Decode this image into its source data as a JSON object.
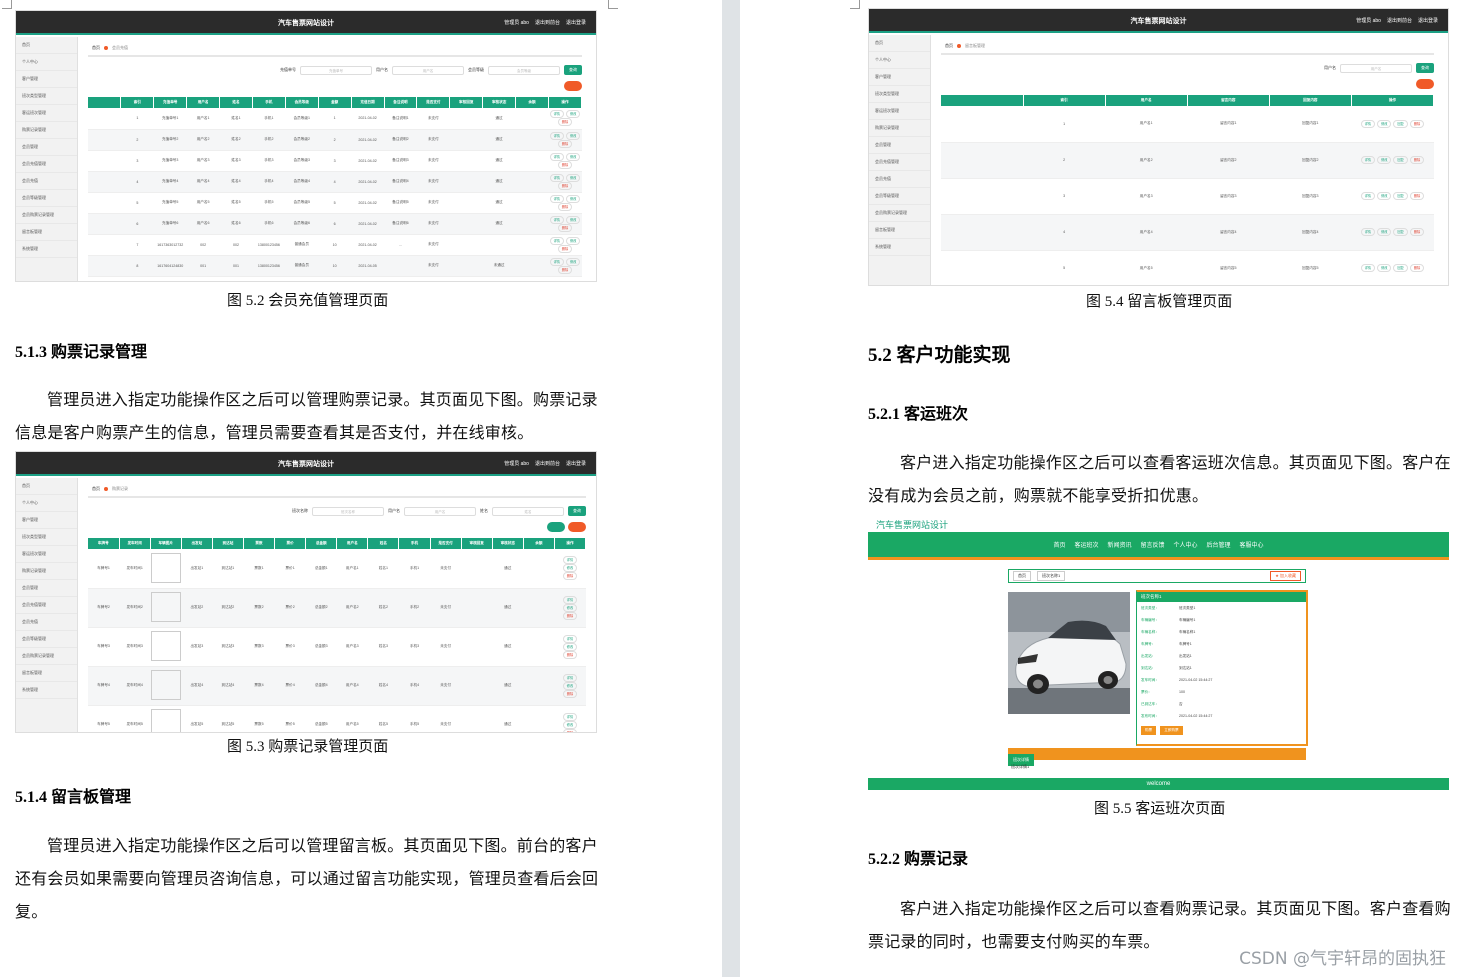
{
  "app": {
    "title": "汽车售票网站设计",
    "header_links": [
      "管理员 abo",
      "退出到前台",
      "退出登录"
    ]
  },
  "sidebar_full": [
    "首页",
    "个人中心",
    "客户管理",
    "班次类型管理",
    "客运班次管理",
    "购票记录管理",
    "会员管理",
    "会员充值管理",
    "会员充值",
    "会员等级管理",
    "会员购票记录管理",
    "留言板管理",
    "系统管理"
  ],
  "fig52": {
    "crumb_home": "首页",
    "crumb_current": "会员充值",
    "search": [
      {
        "label": "充值单号",
        "placeholder": "充值单号"
      },
      {
        "label": "用户名",
        "placeholder": "用户名"
      },
      {
        "label": "会员等级",
        "placeholder": "会员等级"
      }
    ],
    "search_btn": "查询",
    "columns": [
      "",
      "索引",
      "充值单号",
      "用户名",
      "姓名",
      "手机",
      "会员等级",
      "金额",
      "充值日期",
      "备注说明",
      "是否支付",
      "审核回复",
      "审核状态",
      "余额",
      "操作"
    ],
    "rows": [
      [
        "",
        "1",
        "充值单号1",
        "用户名1",
        "姓名1",
        "手机1",
        "会员等级1",
        "1",
        "2021-04-02",
        "备注说明1",
        "未支付",
        "",
        "通过",
        "",
        "详情 修改 删除"
      ],
      [
        "",
        "2",
        "充值单号2",
        "用户名2",
        "姓名2",
        "手机2",
        "会员等级2",
        "2",
        "2021-04-02",
        "备注说明2",
        "未支付",
        "",
        "通过",
        "",
        "详情 修改 删除"
      ],
      [
        "",
        "3",
        "充值单号3",
        "用户名3",
        "姓名3",
        "手机3",
        "会员等级3",
        "3",
        "2021-04-02",
        "备注说明3",
        "未支付",
        "",
        "通过",
        "",
        "详情 修改 删除"
      ],
      [
        "",
        "4",
        "充值单号4",
        "用户名4",
        "姓名4",
        "手机4",
        "会员等级4",
        "4",
        "2021-04-02",
        "备注说明4",
        "未支付",
        "",
        "通过",
        "",
        "详情 修改 删除"
      ],
      [
        "",
        "5",
        "充值单号5",
        "用户名5",
        "姓名5",
        "手机5",
        "会员等级5",
        "5",
        "2021-04-02",
        "备注说明5",
        "未支付",
        "",
        "通过",
        "",
        "详情 修改 删除"
      ],
      [
        "",
        "6",
        "充值单号6",
        "用户名6",
        "姓名6",
        "手机6",
        "会员等级6",
        "6",
        "2021-04-02",
        "备注说明6",
        "未支付",
        "",
        "通过",
        "",
        "详情 修改 删除"
      ],
      [
        "",
        "7",
        "1617363012732",
        "002",
        "002",
        "13800123456",
        "普通会员",
        "10",
        "2021-04-02",
        "...",
        "未支付",
        "",
        "",
        "",
        "详情 修改 删除"
      ],
      [
        "",
        "8",
        "1617604124830",
        "001",
        "001",
        "13800123456",
        "普通会员",
        "10",
        "2021-04-05",
        "",
        "未支付",
        "",
        "未通过",
        "",
        "详情 修改 删除"
      ]
    ]
  },
  "fig53": {
    "crumb_home": "首页",
    "crumb_current": "购票记录",
    "search": [
      {
        "label": "班次名称",
        "placeholder": "班次名称"
      },
      {
        "label": "用户名",
        "placeholder": "用户名"
      },
      {
        "label": "姓名",
        "placeholder": "姓名"
      }
    ],
    "search_btn": "查询",
    "columns": [
      "车牌号",
      "发车时间",
      "车辆图片",
      "出发站",
      "到达站",
      "票数",
      "票价",
      "总金额",
      "用户名",
      "姓名",
      "手机",
      "是否支付",
      "审核回复",
      "审核状态",
      "余额",
      "操作"
    ],
    "rows": [
      [
        "车牌号1",
        "发车时间1",
        "",
        "出发站1",
        "到达站1",
        "票数1",
        "票价1",
        "总金额1",
        "用户名1",
        "姓名1",
        "手机1",
        "未支付",
        "",
        "通过",
        "",
        "详情 修改 删除"
      ],
      [
        "车牌号2",
        "发车时间2",
        "",
        "出发站2",
        "到达站2",
        "票数2",
        "票价2",
        "总金额2",
        "用户名2",
        "姓名2",
        "手机2",
        "未支付",
        "",
        "通过",
        "",
        "详情 修改 删除"
      ],
      [
        "车牌号3",
        "发车时间3",
        "",
        "出发站3",
        "到达站3",
        "票数3",
        "票价3",
        "总金额3",
        "用户名3",
        "姓名3",
        "手机3",
        "未支付",
        "",
        "通过",
        "",
        "详情 修改 删除"
      ],
      [
        "车牌号4",
        "发车时间4",
        "",
        "出发站4",
        "到达站4",
        "票数4",
        "票价4",
        "总金额4",
        "用户名4",
        "姓名4",
        "手机4",
        "未支付",
        "",
        "通过",
        "",
        "详情 修改 删除"
      ],
      [
        "车牌号5",
        "发车时间5",
        "",
        "出发站5",
        "到达站5",
        "票数5",
        "票价5",
        "总金额5",
        "用户名5",
        "姓名5",
        "手机5",
        "未支付",
        "",
        "通过",
        "",
        "详情 修改 删除"
      ]
    ]
  },
  "fig54": {
    "crumb_home": "首页",
    "crumb_current": "留言板管理",
    "search": [
      {
        "label": "用户名",
        "placeholder": "用户名"
      }
    ],
    "search_btn": "查询",
    "columns": [
      "",
      "索引",
      "用户名",
      "留言内容",
      "回复内容",
      "操作"
    ],
    "rows": [
      [
        "",
        "1",
        "用户名1",
        "留言内容1",
        "回复内容1",
        "详情 修改 回复 删除"
      ],
      [
        "",
        "2",
        "用户名2",
        "留言内容2",
        "回复内容2",
        "详情 修改 回复 删除"
      ],
      [
        "",
        "3",
        "用户名3",
        "留言内容3",
        "回复内容3",
        "详情 修改 回复 删除"
      ],
      [
        "",
        "4",
        "用户名4",
        "留言内容4",
        "回复内容4",
        "详情 修改 回复 删除"
      ],
      [
        "",
        "5",
        "用户名5",
        "留言内容5",
        "回复内容5",
        "详情 修改 回复 删除"
      ]
    ]
  },
  "fig55": {
    "site_title": "汽车售票网站设计",
    "nav": [
      "首页",
      "客运班次",
      "新闻资讯",
      "留言反馈",
      "个人中心",
      "后台管理",
      "客服中心"
    ],
    "bar": [
      "首页",
      "班次名称1"
    ],
    "fav": "★ 加入收藏",
    "info_title": "班次名称1",
    "info_rows": [
      [
        "班次类型：",
        "班次类型1"
      ],
      [
        "车辆编号：",
        "车辆编号1"
      ],
      [
        "车辆名称：",
        "车辆名称1"
      ],
      [
        "车牌号：",
        "车牌号1"
      ],
      [
        "出发站：",
        "出发站1"
      ],
      [
        "到达站：",
        "到达站1"
      ],
      [
        "发车时间：",
        "2021-04-02 15:44:27"
      ],
      [
        "票价：",
        "100"
      ],
      [
        "已到达车：",
        "否"
      ],
      [
        "发布时间：",
        "2021-04-02 15:44:27"
      ]
    ],
    "buttons": [
      "购票",
      "立即购票"
    ],
    "detail_tab": "班次详情",
    "detail_text": "班次详情1",
    "footer": "welcome"
  },
  "left": {
    "cap52": "图 5.2  会员充值管理页面",
    "h513": "5.1.3  购票记录管理",
    "p513": "管理员进入指定功能操作区之后可以管理购票记录。其页面见下图。购票记录信息是客户购票产生的信息，管理员需要查看其是否支付，并在线审核。",
    "cap53": "图 5.3  购票记录管理页面",
    "h514": "5.1.4  留言板管理",
    "p514": "管理员进入指定功能操作区之后可以管理留言板。其页面见下图。前台的客户还有会员如果需要向管理员咨询信息，可以通过留言功能实现，管理员查看后会回复。"
  },
  "right": {
    "cap54": "图 5.4  留言板管理页面",
    "h52": "5.2  客户功能实现",
    "h521": "5.2.1  客运班次",
    "p521": "客户进入指定功能操作区之后可以查看客运班次信息。其页面见下图。客户在没有成为会员之前，购票就不能享受折扣优惠。",
    "cap55": "图 5.5  客运班次页面",
    "h522": "5.2.2  购票记录",
    "p522": "客户进入指定功能操作区之后可以查看购票记录。其页面见下图。客户查看购票记录的同时，也需要支付购买的车票。"
  },
  "watermark": "CSDN @气宇轩昂的固执狂"
}
